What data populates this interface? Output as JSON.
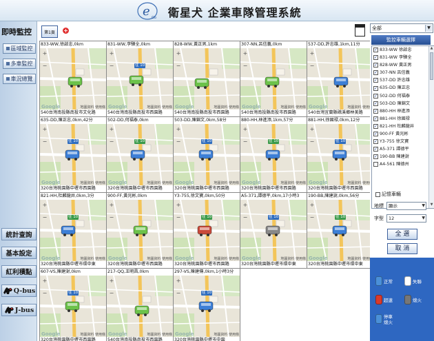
{
  "header": {
    "logo_text": "e",
    "logo_sub": "Go",
    "title": "衛星犬  企業車隊管理系統"
  },
  "sidebar": {
    "heading": "即時監控",
    "buttons": [
      {
        "label": "區域監控"
      },
      {
        "label": "多車監控"
      },
      {
        "label": "車況總覽"
      }
    ],
    "bottom_buttons": [
      {
        "label": "統計查詢"
      },
      {
        "label": "基本設定"
      },
      {
        "label": "紅利積點"
      },
      {
        "label": "Q-bus"
      },
      {
        "label": "J-bus"
      }
    ]
  },
  "tabs": {
    "page_tab": "第1頁",
    "add_symbol": "+"
  },
  "map_common": {
    "zoom_in": "+",
    "zoom_out": "−",
    "google": "Google",
    "attribution": "地圖資料  使用條"
  },
  "cells": [
    {
      "title": "833-WW,徐啟忠,0km",
      "address": "540台灣南投縣南投市文化路"
    },
    {
      "title": "831-WW,李驊全,0km",
      "address": "540台灣南投縣南投市西園路"
    },
    {
      "title": "828-WW,黃正男,1km",
      "address": "540台灣南投縣南投市西園路"
    },
    {
      "title": "307-NN,呂信義,0km",
      "address": "540台灣南投縣南投市西園路"
    },
    {
      "title": "537-DD,許忠雄,1km,11分",
      "address": "540台灣宜蘭縣礁溪鄉林美路"
    },
    {
      "title": "635-DD,陳正忠,0km,42分",
      "address": "320台灣桃園縣中壢市西園路"
    },
    {
      "title": "502-DD,何福泰,0km",
      "address": "320台灣桃園縣中壢市西園路"
    },
    {
      "title": "503-DD,陳錦文,0km,58分",
      "address": "320台灣桃園縣中壢市西園路"
    },
    {
      "title": "880-HH,林進添,1km,57分",
      "address": "320台灣桃園縣中壢市西園路"
    },
    {
      "title": "881-HH,徐國禄,0km,12分",
      "address": "320台灣桃園縣中壢市西園路"
    },
    {
      "title": "821-HH,杜麟龍井,0km,3分",
      "address": "320台灣桃園縣中壢市環中東"
    },
    {
      "title": "900-FF,黃兆彬,0km",
      "address": "320台灣桃園縣中壢市西園路"
    },
    {
      "title": "Y3-755,徐文寶,0km,50分",
      "address": "320台灣桃園縣中壢市西園路"
    },
    {
      "title": "A5-371,譚德平,0km,17小時3",
      "address": "320台灣桃園縣中壢市環中東"
    },
    {
      "title": "190-BB,陳建澍,0km,56分",
      "address": "320台灣桃園縣中壢市環中東"
    },
    {
      "title": "607-VS,陳建澍,0km",
      "address": "320台灣桃園縣中壢市西園路"
    },
    {
      "title": "217-QQ,王明昌,0km",
      "address": "540台灣南投縣南投市西園路"
    },
    {
      "title": "297-VS,陳建傳,0km,1小時3分",
      "address": "320台灣桃園縣中壢市中園"
    }
  ],
  "dest_sign_text": "往 10",
  "right_panel": {
    "group_select": "全部",
    "vehicle_header": "監控車輛選擇",
    "vehicles": [
      "833-WW 徐啟忠",
      "831-WW 李驊全",
      "828-WW 黃正男",
      "307-NN 呂信義",
      "537-DD 許忠雄",
      "635-DD 陳正忠",
      "502-DD 何福泰",
      "503-DD 陳錦文",
      "880-HH 林進添",
      "881-HH 徐國禄",
      "821-HH 杜麟龍井",
      "900-FF 黃兆彬",
      "Y3-755 徐文寶",
      "A5-371 譚德平",
      "190-BB 陳建澍",
      "A4-561 陳德州"
    ],
    "checked_count": 15,
    "record_label": "記憶車輛",
    "map_label": "地標",
    "map_value": "顯示",
    "zoom_label": "字型",
    "zoom_value": "12",
    "select_all": "全 選",
    "clear": "取 消"
  },
  "legend": {
    "items": [
      {
        "label": "正常",
        "color": "#4a90d9"
      },
      {
        "label": "失聯",
        "color": "#ffffff"
      },
      {
        "label": "超速",
        "color": "#d93a2b"
      },
      {
        "label": "熄火",
        "color": "#777777"
      },
      {
        "label": "停車\n熄火",
        "color": "#4a90d9"
      }
    ]
  }
}
